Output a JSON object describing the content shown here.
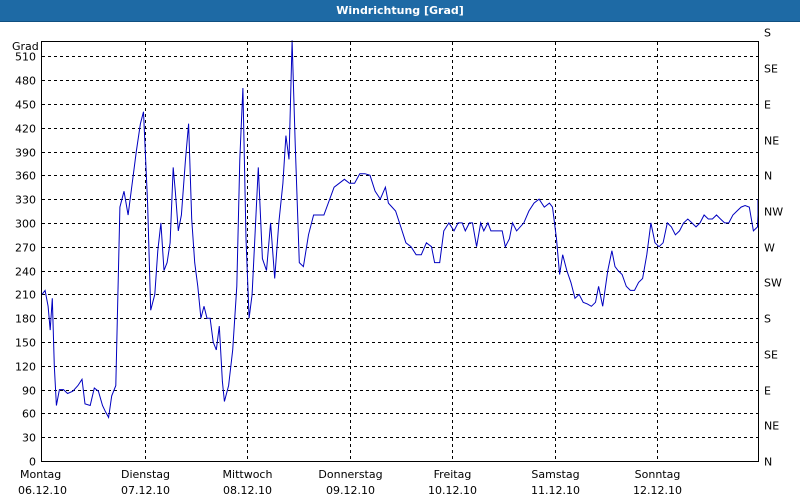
{
  "window": {
    "title": "Windrichtung [Grad]"
  },
  "chart_data": {
    "type": "line",
    "title": "Windrichtung [Grad]",
    "ylabel": "Grad",
    "ylim": [
      0,
      540
    ],
    "y_ticks": [
      0,
      30,
      60,
      90,
      120,
      150,
      180,
      210,
      240,
      270,
      300,
      330,
      360,
      390,
      420,
      450,
      480,
      510
    ],
    "y2_ticks": [
      "N",
      "NE",
      "E",
      "SE",
      "S",
      "SW",
      "W",
      "NW",
      "N",
      "NE",
      "E",
      "SE",
      "S"
    ],
    "grid": true,
    "x_categories": [
      {
        "day": "Montag",
        "date": "06.12.10"
      },
      {
        "day": "Dienstag",
        "date": "07.12.10"
      },
      {
        "day": "Mittwoch",
        "date": "08.12.10"
      },
      {
        "day": "Donnerstag",
        "date": "09.12.10"
      },
      {
        "day": "Freitag",
        "date": "10.12.10"
      },
      {
        "day": "Samstag",
        "date": "11.12.10"
      },
      {
        "day": "Sonntag",
        "date": "12.12.10"
      }
    ],
    "x_unit": "days since Montag 06.12.10 00:00",
    "xlim": [
      0,
      7.1
    ],
    "series": [
      {
        "name": "",
        "color": "#0000c0",
        "points": [
          [
            0.0,
            210
          ],
          [
            0.03,
            215
          ],
          [
            0.06,
            195
          ],
          [
            0.08,
            165
          ],
          [
            0.1,
            205
          ],
          [
            0.12,
            120
          ],
          [
            0.14,
            70
          ],
          [
            0.17,
            90
          ],
          [
            0.21,
            90
          ],
          [
            0.25,
            85
          ],
          [
            0.3,
            88
          ],
          [
            0.35,
            95
          ],
          [
            0.39,
            103
          ],
          [
            0.42,
            72
          ],
          [
            0.47,
            70
          ],
          [
            0.51,
            92
          ],
          [
            0.55,
            88
          ],
          [
            0.59,
            70
          ],
          [
            0.62,
            62
          ],
          [
            0.65,
            55
          ],
          [
            0.68,
            82
          ],
          [
            0.72,
            95
          ],
          [
            0.76,
            320
          ],
          [
            0.8,
            340
          ],
          [
            0.84,
            310
          ],
          [
            0.88,
            350
          ],
          [
            0.92,
            390
          ],
          [
            0.96,
            425
          ],
          [
            0.99,
            440
          ],
          [
            1.03,
            325
          ],
          [
            1.06,
            190
          ],
          [
            1.1,
            210
          ],
          [
            1.13,
            265
          ],
          [
            1.16,
            300
          ],
          [
            1.19,
            240
          ],
          [
            1.22,
            250
          ],
          [
            1.25,
            275
          ],
          [
            1.28,
            370
          ],
          [
            1.3,
            340
          ],
          [
            1.33,
            290
          ],
          [
            1.36,
            310
          ],
          [
            1.4,
            380
          ],
          [
            1.43,
            425
          ],
          [
            1.46,
            305
          ],
          [
            1.49,
            250
          ],
          [
            1.52,
            220
          ],
          [
            1.55,
            180
          ],
          [
            1.58,
            195
          ],
          [
            1.61,
            180
          ],
          [
            1.64,
            180
          ],
          [
            1.67,
            150
          ],
          [
            1.7,
            140
          ],
          [
            1.73,
            170
          ],
          [
            1.76,
            100
          ],
          [
            1.78,
            75
          ],
          [
            1.82,
            95
          ],
          [
            1.86,
            140
          ],
          [
            1.9,
            220
          ],
          [
            1.93,
            380
          ],
          [
            1.96,
            470
          ],
          [
            1.99,
            280
          ],
          [
            2.02,
            180
          ],
          [
            2.05,
            210
          ],
          [
            2.08,
            290
          ],
          [
            2.11,
            370
          ],
          [
            2.15,
            255
          ],
          [
            2.19,
            240
          ],
          [
            2.23,
            300
          ],
          [
            2.27,
            230
          ],
          [
            2.31,
            300
          ],
          [
            2.35,
            350
          ],
          [
            2.38,
            410
          ],
          [
            2.41,
            380
          ],
          [
            2.44,
            530
          ],
          [
            2.47,
            400
          ],
          [
            2.51,
            250
          ],
          [
            2.55,
            245
          ],
          [
            2.6,
            285
          ],
          [
            2.65,
            310
          ],
          [
            2.75,
            310
          ],
          [
            2.85,
            345
          ],
          [
            2.95,
            355
          ],
          [
            3.0,
            350
          ],
          [
            3.05,
            350
          ],
          [
            3.1,
            362
          ],
          [
            3.15,
            362
          ],
          [
            3.2,
            360
          ],
          [
            3.25,
            340
          ],
          [
            3.3,
            330
          ],
          [
            3.35,
            345
          ],
          [
            3.38,
            325
          ],
          [
            3.45,
            315
          ],
          [
            3.5,
            295
          ],
          [
            3.55,
            275
          ],
          [
            3.6,
            270
          ],
          [
            3.65,
            260
          ],
          [
            3.7,
            260
          ],
          [
            3.75,
            275
          ],
          [
            3.8,
            270
          ],
          [
            3.83,
            250
          ],
          [
            3.88,
            250
          ],
          [
            3.92,
            290
          ],
          [
            3.97,
            300
          ],
          [
            4.02,
            290
          ],
          [
            4.06,
            300
          ],
          [
            4.1,
            300
          ],
          [
            4.13,
            290
          ],
          [
            4.17,
            300
          ],
          [
            4.2,
            300
          ],
          [
            4.24,
            270
          ],
          [
            4.28,
            300
          ],
          [
            4.31,
            290
          ],
          [
            4.35,
            300
          ],
          [
            4.38,
            290
          ],
          [
            4.42,
            290
          ],
          [
            4.45,
            290
          ],
          [
            4.49,
            290
          ],
          [
            4.52,
            270
          ],
          [
            4.56,
            280
          ],
          [
            4.59,
            300
          ],
          [
            4.63,
            290
          ],
          [
            4.7,
            300
          ],
          [
            4.75,
            315
          ],
          [
            4.8,
            325
          ],
          [
            4.85,
            330
          ],
          [
            4.9,
            320
          ],
          [
            4.95,
            325
          ],
          [
            4.98,
            320
          ],
          [
            5.02,
            280
          ],
          [
            5.05,
            235
          ],
          [
            5.08,
            260
          ],
          [
            5.12,
            240
          ],
          [
            5.16,
            225
          ],
          [
            5.2,
            205
          ],
          [
            5.24,
            210
          ],
          [
            5.28,
            200
          ],
          [
            5.32,
            198
          ],
          [
            5.36,
            195
          ],
          [
            5.4,
            200
          ],
          [
            5.43,
            220
          ],
          [
            5.47,
            195
          ],
          [
            5.52,
            240
          ],
          [
            5.56,
            265
          ],
          [
            5.59,
            245
          ],
          [
            5.62,
            240
          ],
          [
            5.66,
            235
          ],
          [
            5.7,
            220
          ],
          [
            5.74,
            215
          ],
          [
            5.78,
            215
          ],
          [
            5.82,
            225
          ],
          [
            5.86,
            230
          ],
          [
            5.9,
            260
          ],
          [
            5.94,
            300
          ],
          [
            5.98,
            275
          ],
          [
            6.02,
            270
          ],
          [
            6.06,
            275
          ],
          [
            6.1,
            300
          ],
          [
            6.14,
            295
          ],
          [
            6.18,
            285
          ],
          [
            6.22,
            290
          ],
          [
            6.26,
            300
          ],
          [
            6.3,
            305
          ],
          [
            6.34,
            300
          ],
          [
            6.38,
            295
          ],
          [
            6.42,
            300
          ],
          [
            6.46,
            310
          ],
          [
            6.5,
            305
          ],
          [
            6.54,
            305
          ],
          [
            6.58,
            310
          ],
          [
            6.62,
            305
          ],
          [
            6.66,
            300
          ],
          [
            6.7,
            300
          ],
          [
            6.74,
            310
          ],
          [
            6.78,
            315
          ],
          [
            6.82,
            320
          ],
          [
            6.86,
            322
          ],
          [
            6.9,
            320
          ],
          [
            6.94,
            290
          ],
          [
            6.98,
            295
          ],
          [
            7.02,
            310
          ],
          [
            7.06,
            330
          ],
          [
            7.1,
            330
          ]
        ]
      }
    ]
  }
}
